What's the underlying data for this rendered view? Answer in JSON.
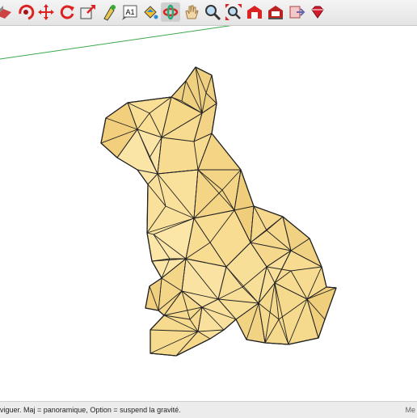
{
  "toolbar": {
    "tools": [
      {
        "name": "section-plane-icon"
      },
      {
        "name": "orbit-red-icon"
      },
      {
        "name": "move-icon"
      },
      {
        "name": "rotate-icon"
      },
      {
        "name": "scale-icon"
      },
      {
        "name": "pushpull-icon"
      },
      {
        "name": "text-icon",
        "label": "A1"
      },
      {
        "name": "paint-bucket-icon"
      },
      {
        "name": "orbit-icon",
        "active": true
      },
      {
        "name": "pan-hand-icon"
      },
      {
        "name": "zoom-icon"
      },
      {
        "name": "zoom-extents-icon"
      },
      {
        "name": "warehouse-icon"
      },
      {
        "name": "extension-warehouse-icon"
      },
      {
        "name": "send-to-layout-icon"
      },
      {
        "name": "ruby-icon"
      }
    ]
  },
  "status": {
    "text": "viguer. Maj = panoramique, Option =  suspend la gravité.",
    "right": "Me"
  },
  "colors": {
    "face": "#f6d889",
    "edge": "#222222",
    "axis_green": "#3aa84a"
  }
}
